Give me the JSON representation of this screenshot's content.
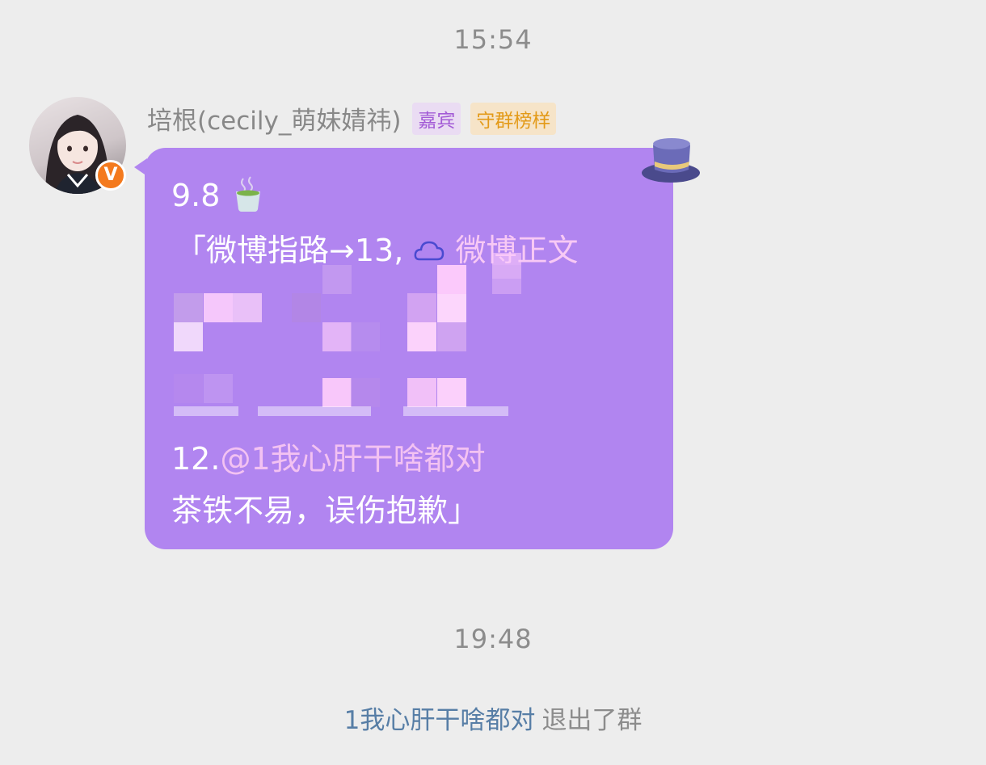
{
  "chat": {
    "timestamp_1": "15:54",
    "timestamp_2": "19:48",
    "sender": {
      "name": "培根(cecily_萌妹婧祎)",
      "tags": [
        "嘉宾",
        "守群榜样"
      ],
      "verified_badge": "V"
    },
    "message": {
      "line1": "9.8",
      "line1_icon": "tea-cup-icon",
      "line2_prefix": "「微博指路→13,",
      "line2_icon": "weibo-cloud-icon",
      "line2_link": "微博正文",
      "line3_prefix": "12.",
      "line3_mention": "@1我心肝干啥都对",
      "line4": "茶铁不易，误伤抱歉」",
      "decoration_icon": "top-hat-icon"
    },
    "system_event": {
      "user": "1我心肝干啥都对",
      "text": "退出了群"
    }
  },
  "colors": {
    "background": "#ededed",
    "bubble": "#b185f0",
    "link": "#f8c9f5",
    "system_user": "#577ea6",
    "badge": "#f47a1e"
  }
}
